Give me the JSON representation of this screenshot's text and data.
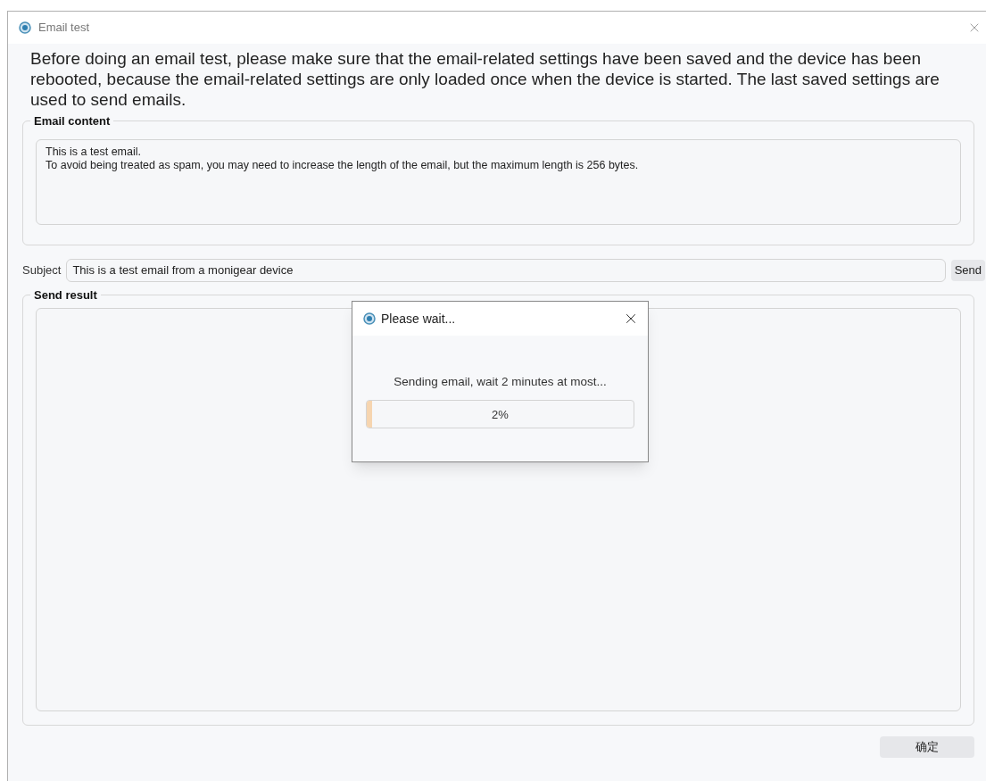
{
  "window": {
    "title": "Email test"
  },
  "notice": "Before doing an email test, please make sure that the email-related settings have been saved and the device has been rebooted, because the email-related settings are only loaded once when the device is started. The last saved settings are used to send emails.",
  "email_content": {
    "legend": "Email content",
    "lines": [
      "This is a test email.",
      "To avoid being treated as spam, you may need to increase the length of the email, but the maximum length is 256 bytes."
    ]
  },
  "subject": {
    "label": "Subject",
    "value": "This is a test email from a monigear device",
    "button": "Send"
  },
  "send_result": {
    "legend": "Send result"
  },
  "ok_button": "确定",
  "dialog": {
    "title": "Please wait...",
    "message": "Sending email, wait 2 minutes at most...",
    "progress": {
      "level": 0.02,
      "reading": "2%"
    }
  }
}
